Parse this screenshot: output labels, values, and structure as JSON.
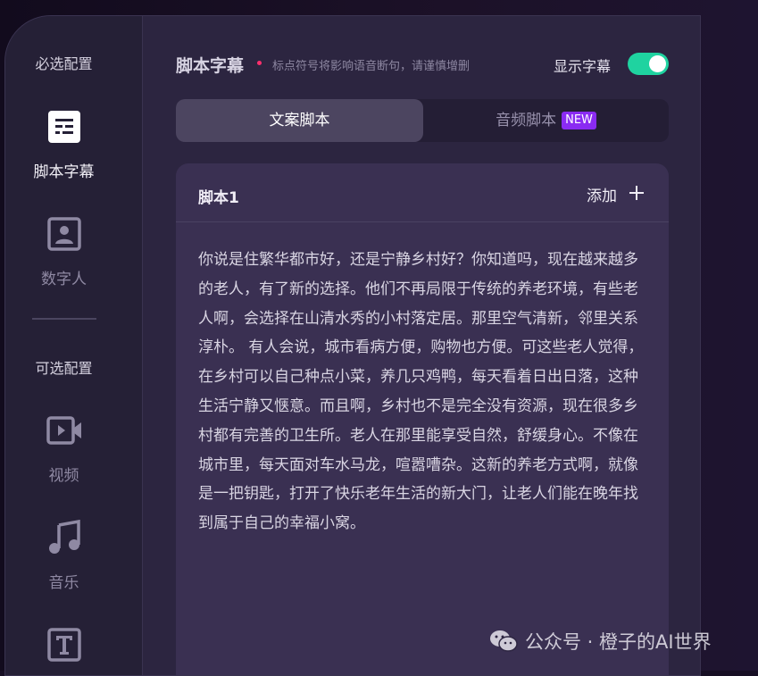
{
  "sidebar": {
    "required_heading": "必选配置",
    "optional_heading": "可选配置",
    "items": [
      {
        "label": "脚本字幕",
        "icon": "script-icon",
        "active": true
      },
      {
        "label": "数字人",
        "icon": "avatar-icon",
        "active": false
      },
      {
        "label": "视频",
        "icon": "video-icon",
        "active": false
      },
      {
        "label": "音乐",
        "icon": "music-icon",
        "active": false
      },
      {
        "label": "",
        "icon": "text-icon",
        "active": false
      }
    ]
  },
  "header": {
    "title": "脚本字幕",
    "hint": "标点符号将影响语音断句，请谨慎增删",
    "show_subtitle_label": "显示字幕",
    "show_subtitle_on": true
  },
  "tabs": [
    {
      "label": "文案脚本",
      "active": true
    },
    {
      "label": "音频脚本",
      "badge": "NEW",
      "active": false
    }
  ],
  "script_card": {
    "title": "脚本1",
    "add_label": "添加",
    "text": "你说是住繁华都市好，还是宁静乡村好？你知道吗，现在越来越多的老人，有了新的选择。他们不再局限于传统的养老环境，有些老人啊，会选择在山清水秀的小村落定居。那里空气清新，邻里关系淳朴。 有人会说，城市看病方便，购物也方便。可这些老人觉得，在乡村可以自己种点小菜，养几只鸡鸭，每天看着日出日落，这种生活宁静又惬意。而且啊，乡村也不是完全没有资源，现在很多乡村都有完善的卫生所。老人在那里能享受自然，舒缓身心。不像在城市里，每天面对车水马龙，喧嚣嘈杂。这新的养老方式啊，就像是一把钥匙，打开了快乐老年生活的新大门，让老人们能在晚年找到属于自己的幸福小窝。"
  },
  "watermark": {
    "text": "公众号 · 橙子的AI世界",
    "icon": "wechat-icon"
  },
  "colors": {
    "toggle_on": "#1fd3a0",
    "new_badge": "#8a2bf2",
    "required_dot": "#ff2f6d"
  }
}
